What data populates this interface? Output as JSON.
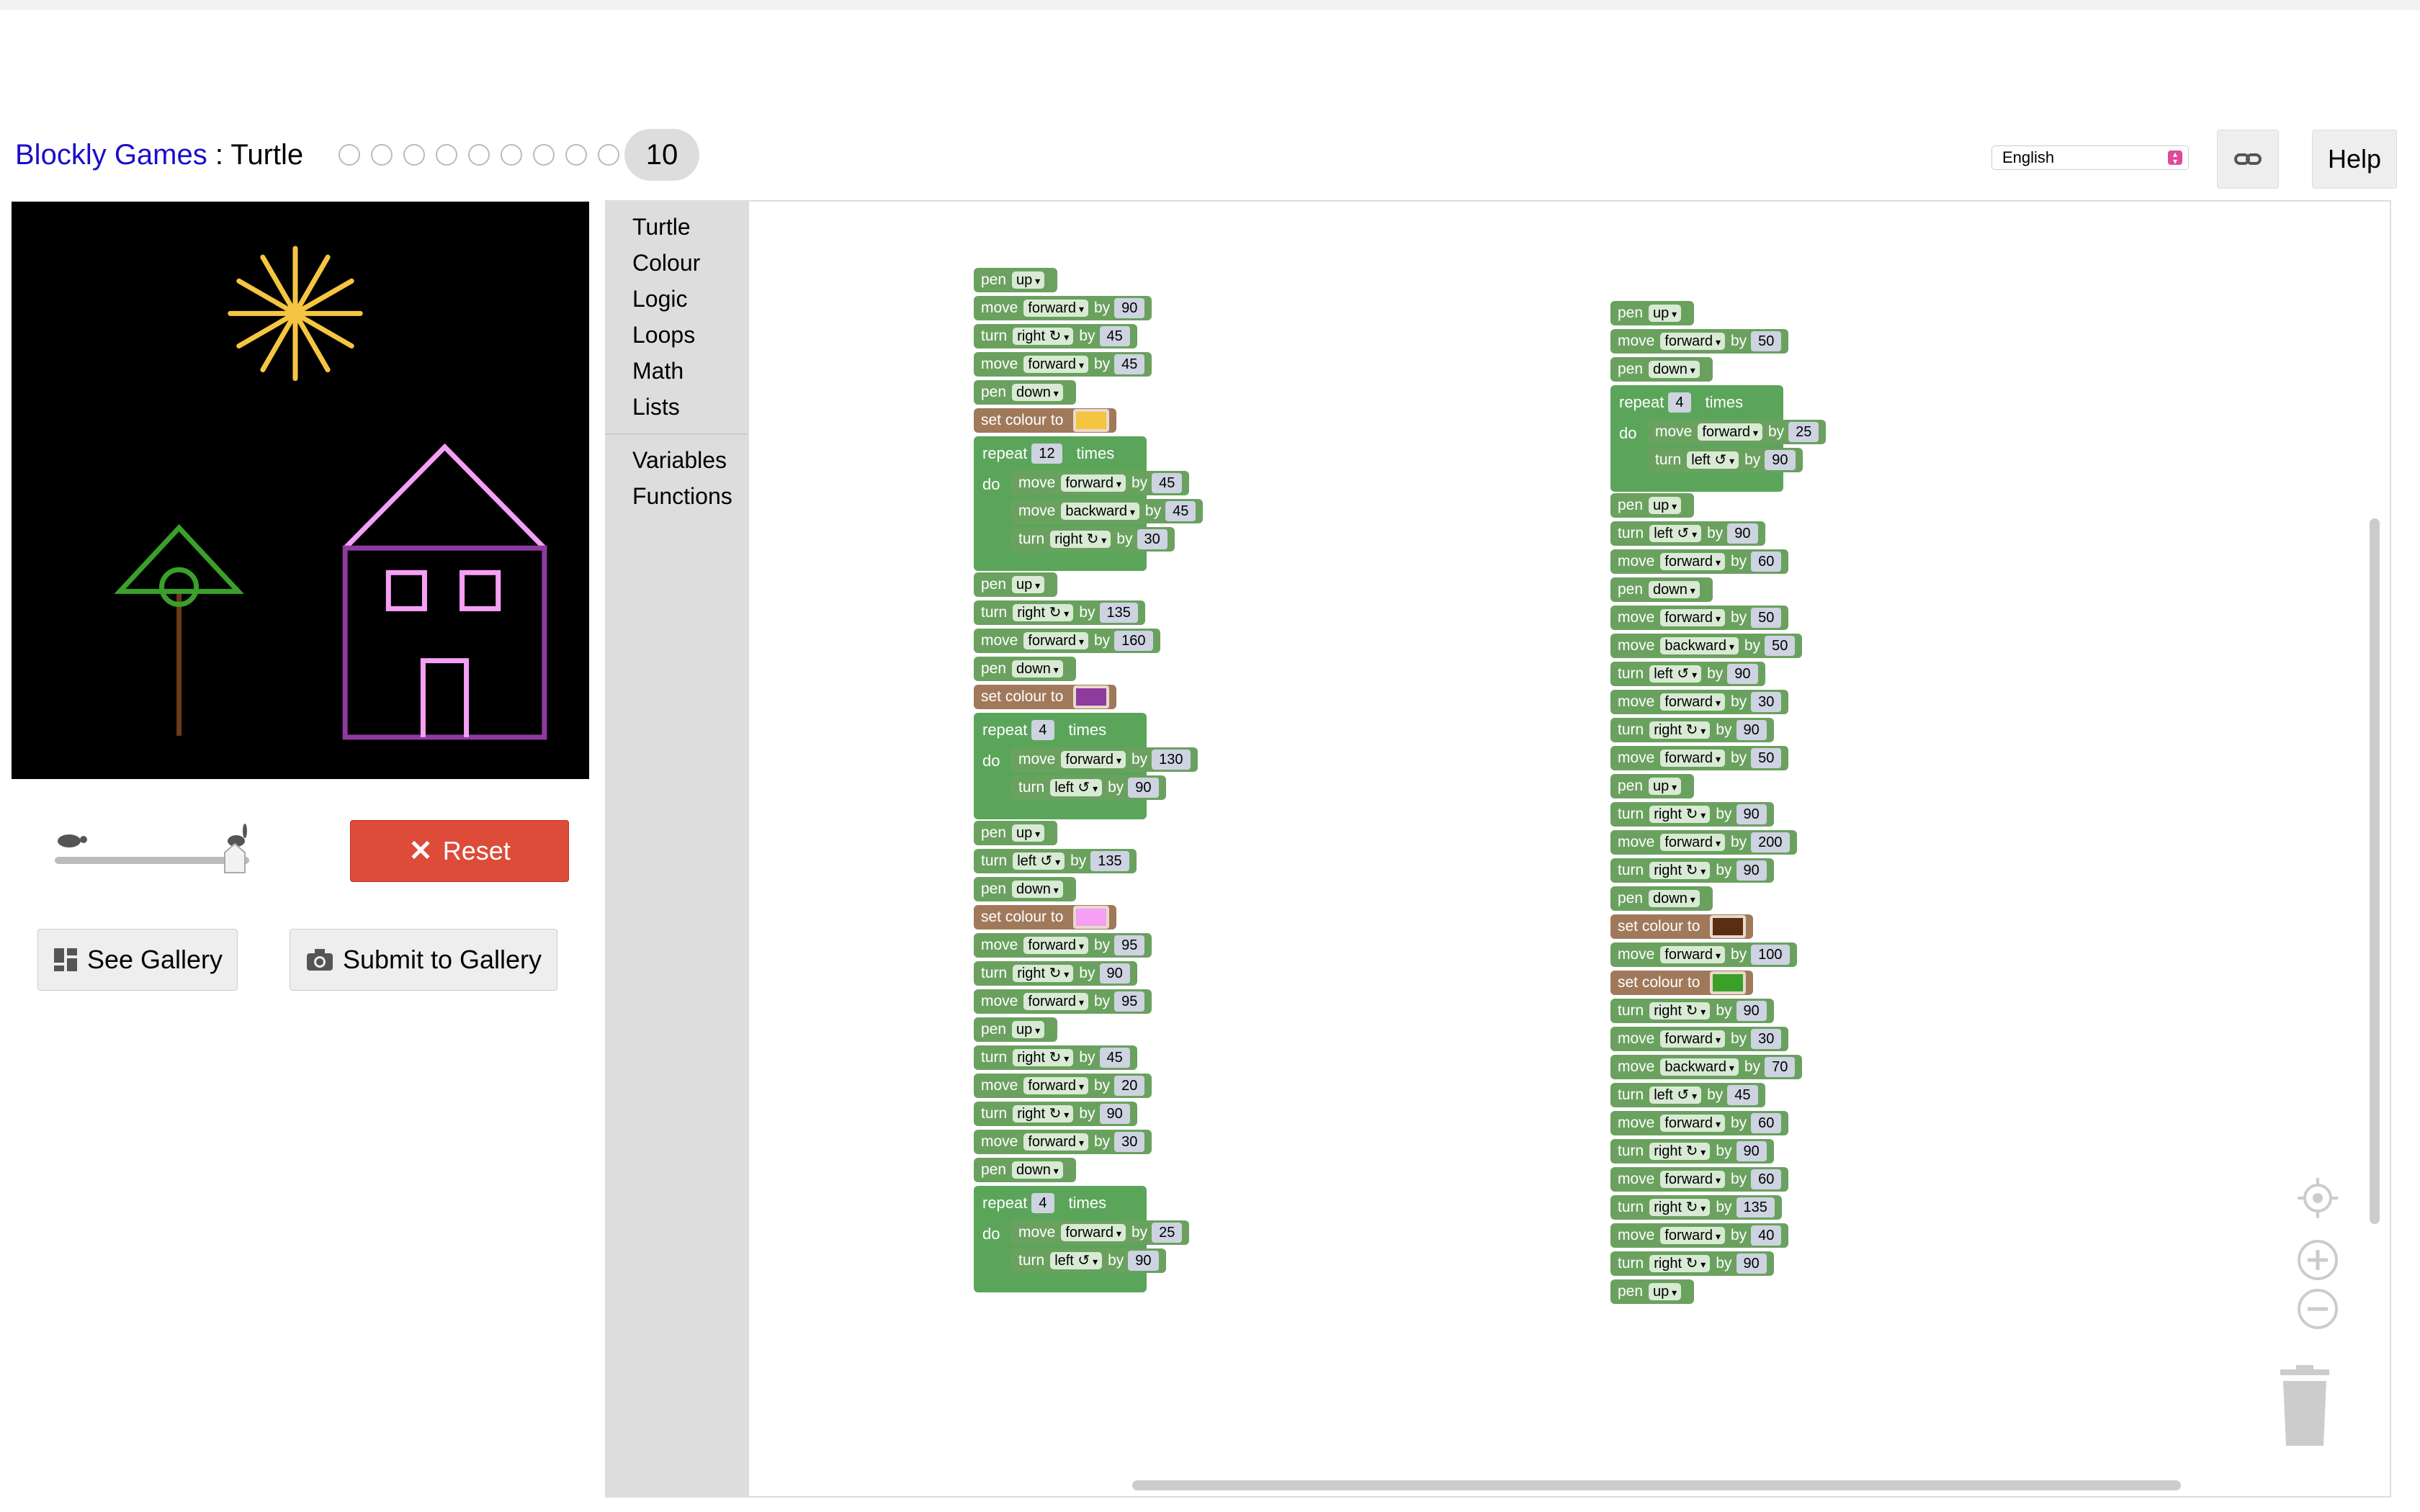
{
  "header": {
    "app_link": "Blockly Games",
    "separator": " : ",
    "game": "Turtle",
    "current_level": "10",
    "language": "English",
    "help_label": "Help"
  },
  "controls": {
    "reset_label": "Reset",
    "gallery_label": "See Gallery",
    "submit_label": "Submit to Gallery",
    "speed": 1.0
  },
  "toolbox": {
    "categories": [
      "Turtle",
      "Colour",
      "Logic",
      "Loops",
      "Math",
      "Lists"
    ],
    "categories2": [
      "Variables",
      "Functions"
    ]
  },
  "blocks": {
    "col1": [
      {
        "k": "pen",
        "a": "up"
      },
      {
        "k": "move",
        "a": "forward",
        "n": "90"
      },
      {
        "k": "turn",
        "a": "right ↻",
        "n": "45"
      },
      {
        "k": "move",
        "a": "forward",
        "n": "45"
      },
      {
        "k": "pen",
        "a": "down"
      },
      {
        "k": "colour",
        "c": "#f5c542"
      },
      {
        "k": "repeat",
        "n": "12",
        "body": [
          {
            "k": "move",
            "a": "forward",
            "n": "45"
          },
          {
            "k": "move",
            "a": "backward",
            "n": "45"
          },
          {
            "k": "turn",
            "a": "right ↻",
            "n": "30"
          }
        ]
      },
      {
        "k": "pen",
        "a": "up"
      },
      {
        "k": "turn",
        "a": "right ↻",
        "n": "135"
      },
      {
        "k": "move",
        "a": "forward",
        "n": "160"
      },
      {
        "k": "pen",
        "a": "down"
      },
      {
        "k": "colour",
        "c": "#8e3a9e"
      },
      {
        "k": "repeat",
        "n": "4",
        "body": [
          {
            "k": "move",
            "a": "forward",
            "n": "130"
          },
          {
            "k": "turn",
            "a": "left ↺",
            "n": "90"
          }
        ]
      },
      {
        "k": "pen",
        "a": "up"
      },
      {
        "k": "turn",
        "a": "left ↺",
        "n": "135"
      },
      {
        "k": "pen",
        "a": "down"
      },
      {
        "k": "colour",
        "c": "#f59ff5"
      },
      {
        "k": "move",
        "a": "forward",
        "n": "95"
      },
      {
        "k": "turn",
        "a": "right ↻",
        "n": "90"
      },
      {
        "k": "move",
        "a": "forward",
        "n": "95"
      },
      {
        "k": "pen",
        "a": "up"
      },
      {
        "k": "turn",
        "a": "right ↻",
        "n": "45"
      },
      {
        "k": "move",
        "a": "forward",
        "n": "20"
      },
      {
        "k": "turn",
        "a": "right ↻",
        "n": "90"
      },
      {
        "k": "move",
        "a": "forward",
        "n": "30"
      },
      {
        "k": "pen",
        "a": "down"
      },
      {
        "k": "repeat",
        "n": "4",
        "body": [
          {
            "k": "move",
            "a": "forward",
            "n": "25"
          },
          {
            "k": "turn",
            "a": "left ↺",
            "n": "90"
          }
        ]
      }
    ],
    "col2": [
      {
        "k": "pen",
        "a": "up"
      },
      {
        "k": "move",
        "a": "forward",
        "n": "50"
      },
      {
        "k": "pen",
        "a": "down"
      },
      {
        "k": "repeat",
        "n": "4",
        "body": [
          {
            "k": "move",
            "a": "forward",
            "n": "25"
          },
          {
            "k": "turn",
            "a": "left ↺",
            "n": "90"
          }
        ]
      },
      {
        "k": "pen",
        "a": "up"
      },
      {
        "k": "turn",
        "a": "left ↺",
        "n": "90"
      },
      {
        "k": "move",
        "a": "forward",
        "n": "60"
      },
      {
        "k": "pen",
        "a": "down"
      },
      {
        "k": "move",
        "a": "forward",
        "n": "50"
      },
      {
        "k": "move",
        "a": "backward",
        "n": "50"
      },
      {
        "k": "turn",
        "a": "left ↺",
        "n": "90"
      },
      {
        "k": "move",
        "a": "forward",
        "n": "30"
      },
      {
        "k": "turn",
        "a": "right ↻",
        "n": "90"
      },
      {
        "k": "move",
        "a": "forward",
        "n": "50"
      },
      {
        "k": "pen",
        "a": "up"
      },
      {
        "k": "turn",
        "a": "right ↻",
        "n": "90"
      },
      {
        "k": "move",
        "a": "forward",
        "n": "200"
      },
      {
        "k": "turn",
        "a": "right ↻",
        "n": "90"
      },
      {
        "k": "pen",
        "a": "down"
      },
      {
        "k": "colour",
        "c": "#5a2e12"
      },
      {
        "k": "move",
        "a": "forward",
        "n": "100"
      },
      {
        "k": "colour",
        "c": "#3aa02a"
      },
      {
        "k": "turn",
        "a": "right ↻",
        "n": "90"
      },
      {
        "k": "move",
        "a": "forward",
        "n": "30"
      },
      {
        "k": "move",
        "a": "backward",
        "n": "70"
      },
      {
        "k": "turn",
        "a": "left ↺",
        "n": "45"
      },
      {
        "k": "move",
        "a": "forward",
        "n": "60"
      },
      {
        "k": "turn",
        "a": "right ↻",
        "n": "90"
      },
      {
        "k": "move",
        "a": "forward",
        "n": "60"
      },
      {
        "k": "turn",
        "a": "right ↻",
        "n": "135"
      },
      {
        "k": "move",
        "a": "forward",
        "n": "40"
      },
      {
        "k": "turn",
        "a": "right ↻",
        "n": "90"
      },
      {
        "k": "pen",
        "a": "up"
      }
    ]
  },
  "labels": {
    "pen": "pen",
    "move": "move",
    "turn": "turn",
    "by": "by",
    "set_colour": "set colour to",
    "repeat": "repeat",
    "times": "times",
    "do": "do"
  }
}
